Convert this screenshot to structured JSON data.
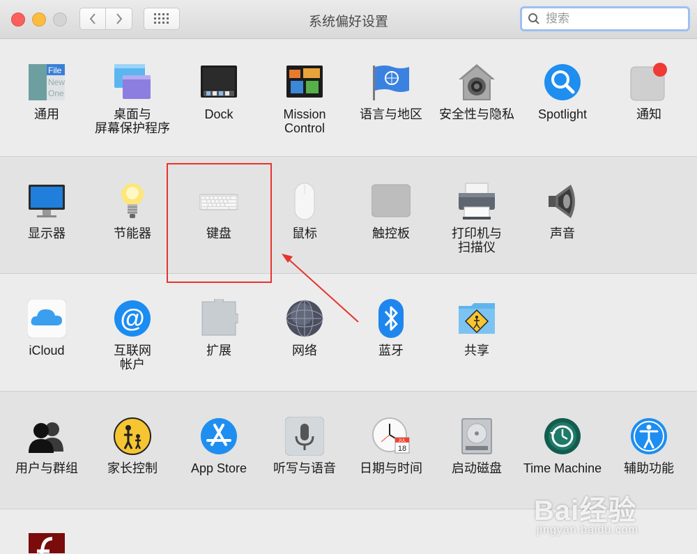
{
  "window": {
    "title": "系统偏好设置"
  },
  "search": {
    "placeholder": "搜索"
  },
  "sections": [
    {
      "items": [
        {
          "label": "通用"
        },
        {
          "label": "桌面与\n屏幕保护程序"
        },
        {
          "label": "Dock"
        },
        {
          "label": "Mission\nControl"
        },
        {
          "label": "语言与地区"
        },
        {
          "label": "安全性与隐私"
        },
        {
          "label": "Spotlight"
        },
        {
          "label": "通知"
        }
      ]
    },
    {
      "items": [
        {
          "label": "显示器"
        },
        {
          "label": "节能器"
        },
        {
          "label": "键盘"
        },
        {
          "label": "鼠标"
        },
        {
          "label": "触控板"
        },
        {
          "label": "打印机与\n扫描仪"
        },
        {
          "label": "声音"
        }
      ]
    },
    {
      "items": [
        {
          "label": "iCloud"
        },
        {
          "label": "互联网\n帐户"
        },
        {
          "label": "扩展"
        },
        {
          "label": "网络"
        },
        {
          "label": "蓝牙"
        },
        {
          "label": "共享"
        }
      ]
    },
    {
      "items": [
        {
          "label": "用户与群组"
        },
        {
          "label": "家长控制"
        },
        {
          "label": "App Store"
        },
        {
          "label": "听写与语音"
        },
        {
          "label": "日期与时间"
        },
        {
          "label": "启动磁盘"
        },
        {
          "label": "Time Machine"
        },
        {
          "label": "辅助功能"
        }
      ]
    }
  ],
  "icons": {
    "general_file_label": "File",
    "general_new_label": "New",
    "general_open_label": "One",
    "calendar_month": "JUL",
    "calendar_day": "18"
  },
  "watermark": {
    "main": "Bai经验",
    "sub": "jingyan.baidu.com"
  },
  "colors": {
    "highlight_box": "#e8332d",
    "arrow": "#e8332d"
  }
}
